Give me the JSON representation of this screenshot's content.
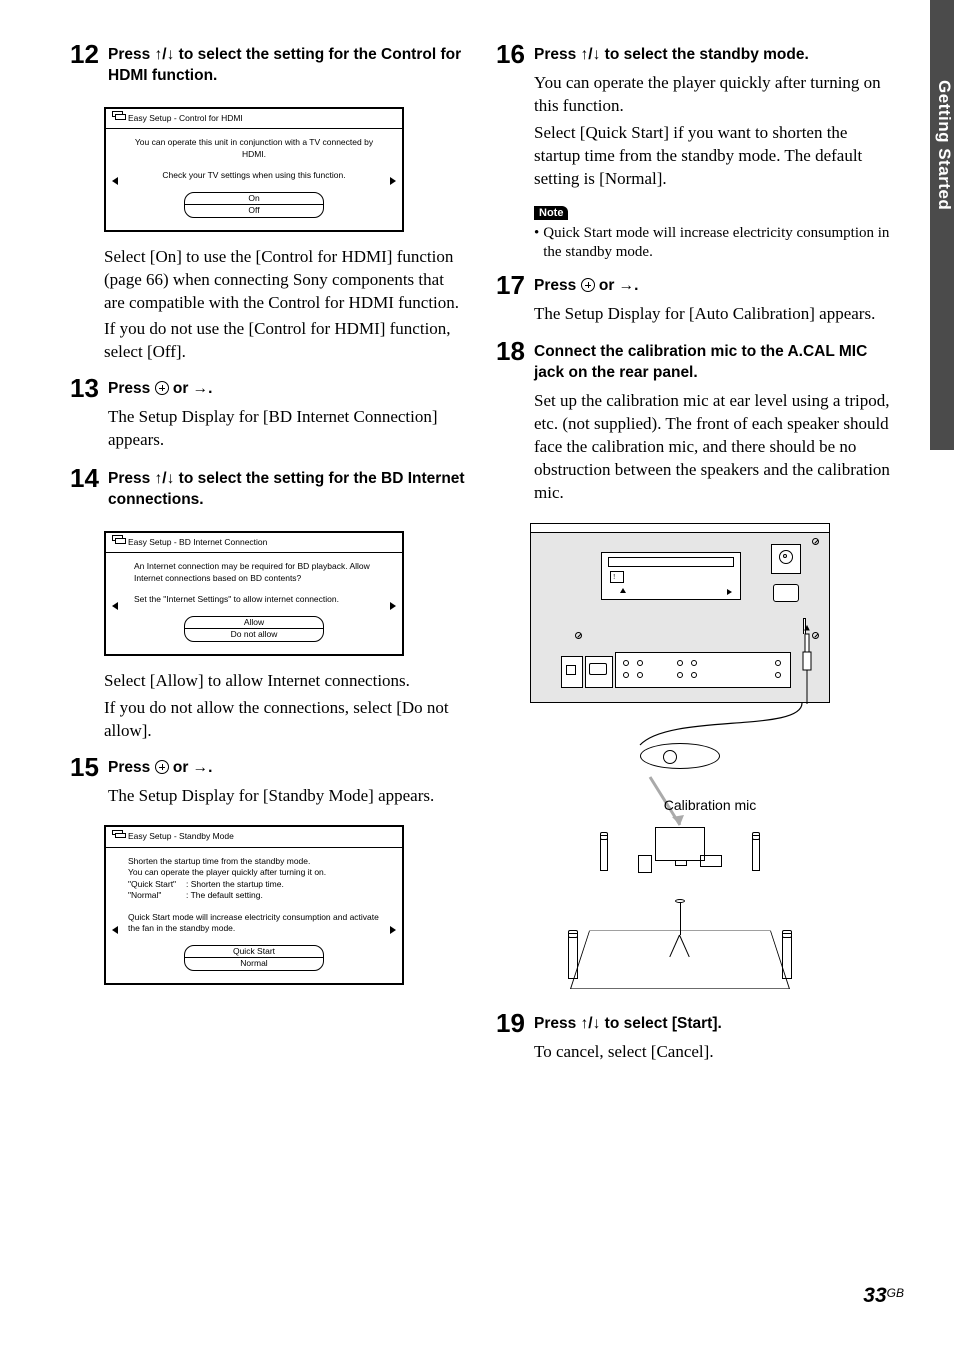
{
  "side_tab": "Getting Started",
  "page_number": "33",
  "page_suffix": "GB",
  "left": {
    "s12": {
      "num": "12",
      "title_a": "Press ",
      "title_b": "/",
      "title_c": " to select the setting for the Control for HDMI function.",
      "screen_title": "Easy Setup - Control for HDMI",
      "msg1": "You can operate this unit in conjunction with a TV connected by HDMI.",
      "msg2": "Check your TV settings when using this function.",
      "opt1": "On",
      "opt2": "Off",
      "body1": "Select [On] to use the [Control for HDMI] function (page 66) when connecting Sony components that are compatible with the Control for HDMI function.",
      "body2": "If you do not use the [Control for HDMI] function, select [Off]."
    },
    "s13": {
      "num": "13",
      "title_a": "Press ",
      "title_b": " or ",
      "title_c": ".",
      "body1": "The Setup Display for [BD Internet Connection] appears."
    },
    "s14": {
      "num": "14",
      "title_a": "Press ",
      "title_b": "/",
      "title_c": " to select the setting for the BD Internet connections.",
      "screen_title": "Easy Setup - BD Internet Connection",
      "msg1": "An Internet connection may be required for BD playback. Allow Internet connections based on BD contents?",
      "msg2": "Set the \"Internet Settings\" to allow internet connection.",
      "opt1": "Allow",
      "opt2": "Do not allow",
      "body1": "Select [Allow] to allow Internet connections.",
      "body2": "If you do not allow the connections, select [Do not allow]."
    },
    "s15": {
      "num": "15",
      "title_a": "Press ",
      "title_b": " or ",
      "title_c": ".",
      "body1": "The Setup Display for [Standby Mode] appears.",
      "screen_title": "Easy Setup - Standby Mode",
      "msg1a": "Shorten the startup time from the standby mode.",
      "msg1b": "You can operate the player quickly after turning it on.",
      "msg1c": "\"Quick Start\"",
      "msg1c_v": ": Shorten the startup time.",
      "msg1d": "\"Normal\"",
      "msg1d_v": ": The default setting.",
      "msg2": "Quick Start mode will increase electricity consumption and activate the fan in the standby mode.",
      "opt1": "Quick Start",
      "opt2": "Normal"
    }
  },
  "right": {
    "s16": {
      "num": "16",
      "title_a": "Press ",
      "title_b": "/",
      "title_c": " to select the standby mode.",
      "body1": "You can operate the player quickly after turning on this function.",
      "body2": "Select [Quick Start] if you want to shorten the startup time from the standby mode. The default setting is [Normal].",
      "note_label": "Note",
      "note_text": "Quick Start mode will increase electricity consumption in the standby mode."
    },
    "s17": {
      "num": "17",
      "title_a": "Press ",
      "title_b": " or ",
      "title_c": ".",
      "body1": "The Setup Display for [Auto Calibration] appears."
    },
    "s18": {
      "num": "18",
      "title": "Connect the calibration mic to the A.CAL MIC jack on the rear panel.",
      "body1": "Set up the calibration mic at ear level using a tripod, etc. (not supplied). The front of each speaker should face the calibration mic, and there should be no obstruction between the speakers and the calibration mic.",
      "mic_label": "Calibration mic"
    },
    "s19": {
      "num": "19",
      "title_a": "Press ",
      "title_b": "/",
      "title_c": " to select [Start].",
      "body1": "To cancel, select [Cancel]."
    }
  }
}
